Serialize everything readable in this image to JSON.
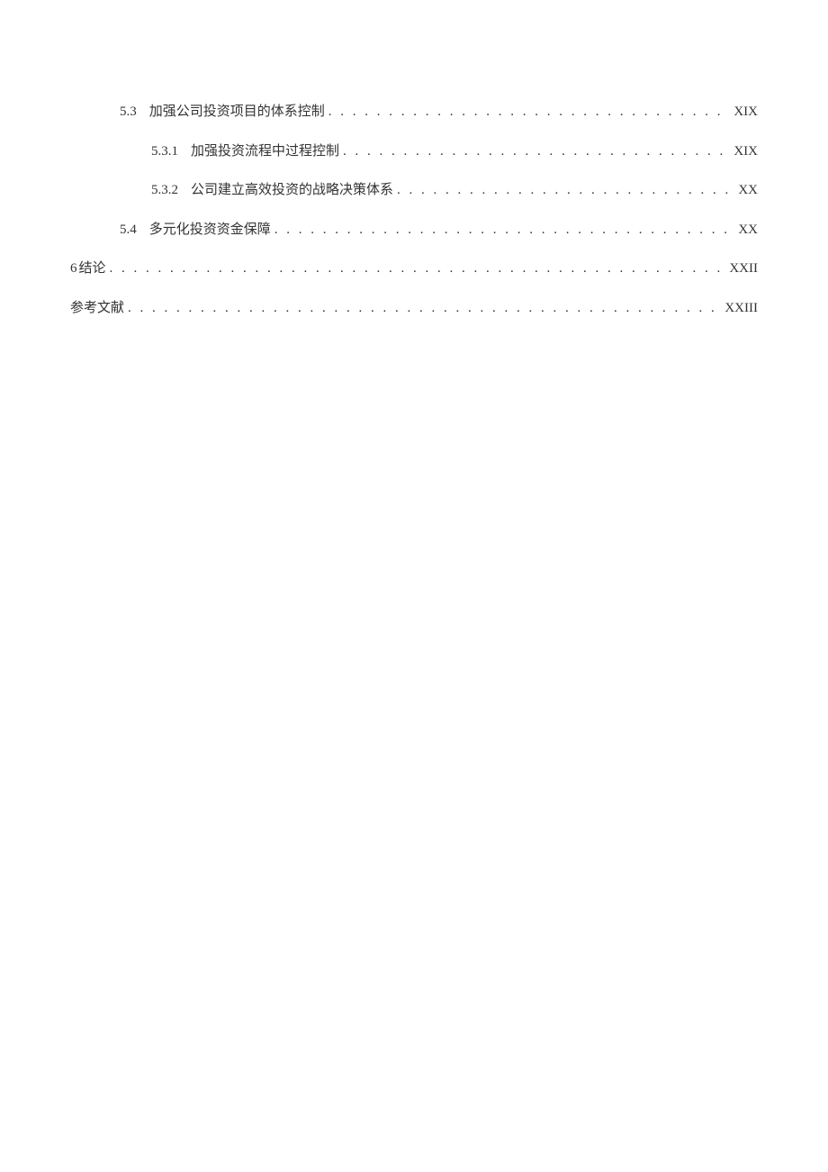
{
  "toc": {
    "entries": [
      {
        "indent": 1,
        "number": "5.3",
        "gapClass": "gap-after-num-sec",
        "title": "加强公司投资项目的体系控制",
        "page": "XIX"
      },
      {
        "indent": 2,
        "number": "5.3.1",
        "gapClass": "gap-after-num-sub",
        "title": "加强投资流程中过程控制",
        "page": "XIX"
      },
      {
        "indent": 2,
        "number": "5.3.2",
        "gapClass": "gap-after-num-sub",
        "title": "公司建立高效投资的战略决策体系",
        "page": "XX"
      },
      {
        "indent": 1,
        "number": "5.4",
        "gapClass": "gap-after-num-sec",
        "title": "多元化投资资金保障",
        "page": "XX"
      },
      {
        "indent": 0,
        "number": "6",
        "gapClass": "gap-after-num-chap",
        "title": "结论",
        "page": "XXII"
      },
      {
        "indent": 0,
        "number": "",
        "gapClass": "",
        "title": "参考文献",
        "page": "XXIII"
      }
    ]
  }
}
